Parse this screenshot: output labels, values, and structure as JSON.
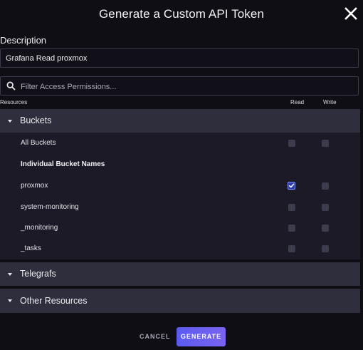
{
  "dialog": {
    "title": "Generate a Custom API Token",
    "close_icon": "close-icon"
  },
  "description": {
    "label": "Description",
    "value": "Grafana Read proxmox"
  },
  "search": {
    "icon": "search-icon",
    "placeholder": "Filter Access Permissions..."
  },
  "columns": {
    "resources": "Resources",
    "read": "Read",
    "write": "Write"
  },
  "groups": {
    "buckets": {
      "label": "Buckets",
      "expanded": true,
      "all_label": "All Buckets",
      "individual_label": "Individual Bucket Names",
      "items": [
        {
          "name": "proxmox",
          "read": true,
          "write": false
        },
        {
          "name": "system-monitoring",
          "read": false,
          "write": false
        },
        {
          "name": "_monitoring",
          "read": false,
          "write": false
        },
        {
          "name": "_tasks",
          "read": false,
          "write": false
        }
      ]
    },
    "telegrafs": {
      "label": "Telegrafs",
      "expanded": false
    },
    "other": {
      "label": "Other Resources",
      "expanded": false
    }
  },
  "footer": {
    "cancel_label": "CANCEL",
    "generate_label": "GENERATE"
  },
  "colors": {
    "background": "#0f0e15",
    "group_header": "#2f2e3d",
    "panel": "#1b1a26",
    "checkbox_checked": "#2f3aa9",
    "generate_gradient_start": "#5b5bf0",
    "generate_gradient_end": "#7a63f0"
  }
}
